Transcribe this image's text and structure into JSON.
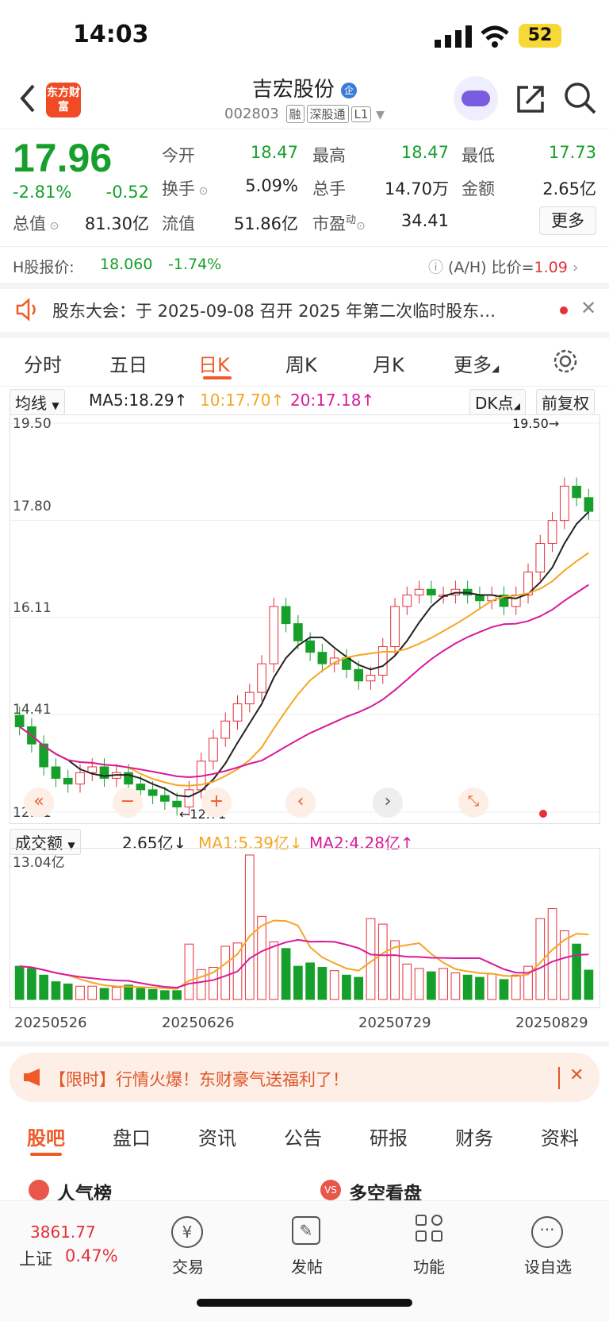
{
  "status": {
    "time": "14:03",
    "battery": "52"
  },
  "header": {
    "logo_text": "东方财富",
    "stock_name": "吉宏股份",
    "stock_code": "002803",
    "tags": [
      "融",
      "深股通",
      "L1"
    ]
  },
  "quote": {
    "price": "17.96",
    "change_pct": "-2.81%",
    "change_amt": "-0.52",
    "open_label": "今开",
    "open": "18.47",
    "high_label": "最高",
    "high": "18.47",
    "low_label": "最低",
    "low": "17.73",
    "turnover_label": "换手",
    "turnover": "5.09%",
    "volume_label": "总手",
    "volume": "14.70万",
    "amount_label": "金额",
    "amount": "2.65亿",
    "mktcap_label": "总值",
    "mktcap": "81.30亿",
    "float_label": "流值",
    "float": "51.86亿",
    "pe_label": "市盈",
    "pe_sup": "动",
    "pe": "34.41",
    "more": "更多"
  },
  "hshare": {
    "label": "H股报价:",
    "price": "18.060",
    "change": "-1.74%",
    "ah_label": "(A/H) 比价=",
    "ah_value": "1.09"
  },
  "notice": {
    "text": "股东大会：于 2025-09-08 召开 2025 年第二次临时股东…"
  },
  "tabs": [
    "分时",
    "五日",
    "日K",
    "周K",
    "月K",
    "更多"
  ],
  "active_tab": "日K",
  "indicator": {
    "dropdown": "均线",
    "ma5": "MA5:18.29↑",
    "ma10": "10:17.70↑",
    "ma20": "20:17.18↑",
    "dk": "DK点",
    "adjust": "前复权",
    "y_labels": [
      "19.50",
      "17.80",
      "16.11",
      "14.41",
      "12.71"
    ],
    "max_label": "19.50→",
    "min_label": "←12.71",
    "colors": {
      "ma5": "#222222",
      "ma10": "#f5a623",
      "ma20": "#d81b9a",
      "up": "#e5303a",
      "down": "#16a02b"
    }
  },
  "volume_bar": {
    "dropdown": "成交额",
    "value": "2.65亿↓",
    "ma1": "MA1:5.39亿↓",
    "ma2": "MA2:4.28亿↑",
    "max_label": "13.04亿",
    "dates": [
      "20250526",
      "20250626",
      "20250729",
      "20250829"
    ]
  },
  "chart_data": {
    "type": "candlestick",
    "ylim": [
      12.71,
      19.5
    ],
    "closes": [
      14.2,
      13.9,
      13.5,
      13.3,
      13.2,
      13.4,
      13.5,
      13.3,
      13.4,
      13.2,
      13.1,
      13.0,
      12.9,
      12.8,
      13.1,
      13.6,
      14.0,
      14.3,
      14.6,
      14.8,
      15.3,
      16.3,
      16.0,
      15.7,
      15.5,
      15.3,
      15.4,
      15.2,
      15.0,
      15.1,
      15.6,
      16.3,
      16.5,
      16.6,
      16.5,
      16.5,
      16.6,
      16.5,
      16.4,
      16.5,
      16.3,
      16.5,
      16.9,
      17.4,
      17.8,
      18.4,
      18.2,
      17.96
    ],
    "volumes": [
      3.0,
      2.8,
      2.2,
      1.6,
      1.4,
      1.2,
      1.2,
      1.0,
      1.1,
      1.3,
      1.0,
      0.9,
      0.8,
      0.8,
      5.0,
      2.7,
      2.9,
      4.8,
      5.1,
      13.04,
      7.5,
      5.2,
      4.6,
      3.0,
      3.3,
      2.9,
      2.6,
      2.2,
      2.0,
      7.3,
      6.8,
      5.3,
      3.2,
      2.8,
      2.5,
      2.8,
      2.4,
      2.2,
      2.0,
      2.3,
      1.8,
      2.2,
      3.0,
      7.3,
      8.2,
      6.2,
      5.0,
      2.65
    ]
  },
  "promo": {
    "text": "【限时】行情火爆！东财豪气送福利了！"
  },
  "bottom_tabs": [
    "股吧",
    "盘口",
    "资讯",
    "公告",
    "研报",
    "财务",
    "资料"
  ],
  "peek": {
    "left": "人气榜",
    "right": "多空看盘"
  },
  "toolbar": {
    "index_value": "3861.77",
    "index_name": "上证",
    "index_change": "0.47%",
    "items": [
      "交易",
      "发帖",
      "功能",
      "设自选"
    ]
  }
}
